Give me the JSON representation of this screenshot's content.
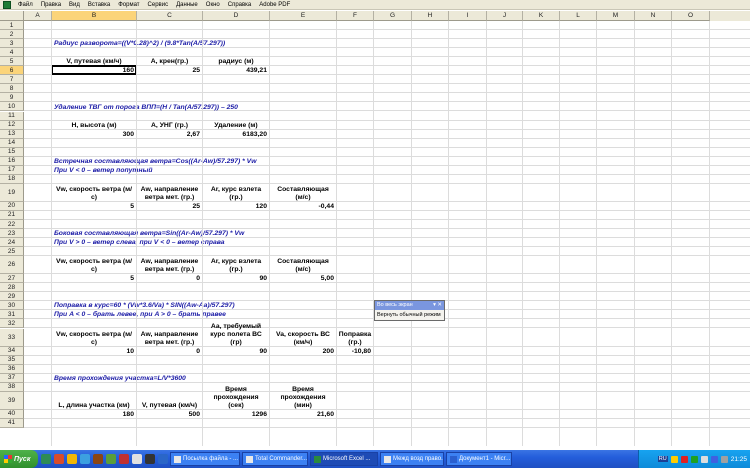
{
  "menu": [
    "Файл",
    "Правка",
    "Вид",
    "Вставка",
    "Формат",
    "Сервис",
    "Данные",
    "Окно",
    "Справка",
    "Adobe PDF"
  ],
  "columns": [
    "A",
    "B",
    "C",
    "D",
    "E",
    "F",
    "G",
    "H",
    "I",
    "J",
    "K",
    "L",
    "M",
    "N",
    "O"
  ],
  "selected_column": "B",
  "selected_row": "6",
  "rows": [
    "1",
    "2",
    "3",
    "4",
    "5",
    "6",
    "7",
    "8",
    "9",
    "10",
    "11",
    "12",
    "13",
    "14",
    "15",
    "16",
    "17",
    "18",
    "19",
    "20",
    "21",
    "22",
    "23",
    "24",
    "25",
    "26",
    "27",
    "28",
    "29",
    "30",
    "31",
    "32",
    "33",
    "34",
    "35",
    "36",
    "37",
    "38",
    "39",
    "40",
    "41"
  ],
  "sheet": {
    "s1": {
      "formula": "Радиус разворота=((V*0.28)^2) / (9.8*Tan(A/57.297))",
      "h_v": "V, путевая (км/ч)",
      "h_a": "А, крен(гр.)",
      "h_r": "радиус (м)",
      "v": "160",
      "a": "25",
      "r": "439,21"
    },
    "s2": {
      "formula": "Удаление ТВГ от порога ВПП=(H / Tan(A/57.297)) – 250",
      "h_h": "H, высота (м)",
      "h_a": "А, УНГ (гр.)",
      "h_d": "Удаление (м)",
      "h": "300",
      "a": "2,67",
      "d": "6183,20"
    },
    "s3": {
      "formula": "Встречная составляющая ветра=Cos((Ar-Aw)/57.297) * Vw",
      "note": "При V < 0 – ветер попутный",
      "h_vw": "Vw, скорость ветра (м/с)",
      "h_aw": "Aw, направление ветра мет. (гр.)",
      "h_ar": "Ar, курс взлета (гр.)",
      "h_c": "Составляющая (м/с)",
      "vw": "5",
      "aw": "25",
      "ar": "120",
      "c": "-0,44"
    },
    "s4": {
      "formula": "Боковая составляющая ветра=Sin((Ar-Aw)/57.297) * Vw",
      "note": "При V > 0 – ветер слева, при V < 0 – ветер справа",
      "h_vw": "Vw, скорость ветра (м/с)",
      "h_aw": "Aw, направление ветра мет. (гр.)",
      "h_ar": "Ar, курс взлета (гр.)",
      "h_c": "Составляющая (м/с)",
      "vw": "5",
      "aw": "0",
      "ar": "90",
      "c": "5,00"
    },
    "s5": {
      "formula": "Поправка в курс=60 * (Vw*3.6/Va) * SIN((Aw-Aa)/57.297)",
      "note": "При A < 0 – брать левее, при A > 0 – брать правее",
      "h_vw": "Vw, скорость ветра (м/с)",
      "h_aw": "Aw, направление ветра мет. (гр.)",
      "h_aa": "Aa, требуемый курс полета ВС (гр)",
      "h_va": "Va, скорость ВС (км/ч)",
      "h_p": "Поправка (гр.)",
      "vw": "10",
      "aw": "0",
      "aa": "90",
      "va": "200",
      "p": "-10,80"
    },
    "s6": {
      "formula": "Время прохождения участка=L/V*3600",
      "h_l": "L, длина участка (км)",
      "h_v": "V, путевая (км/ч)",
      "h_ts": "Время прохождения (сек)",
      "h_tm": "Время прохождения (мин)",
      "l": "180",
      "v": "500",
      "ts": "1296",
      "tm": "21,60"
    }
  },
  "toolbar": {
    "title": "Во весь экран",
    "button": "Вернуть обычный режим"
  },
  "taskbar": {
    "start": "Пуск",
    "tasks": [
      "Посылка файла - ...",
      "Total Commander...",
      "Microsoft Excel ...",
      "Межд возд право...",
      "Документ1 - Micr..."
    ],
    "lang": "RU",
    "clock": "21:25"
  }
}
